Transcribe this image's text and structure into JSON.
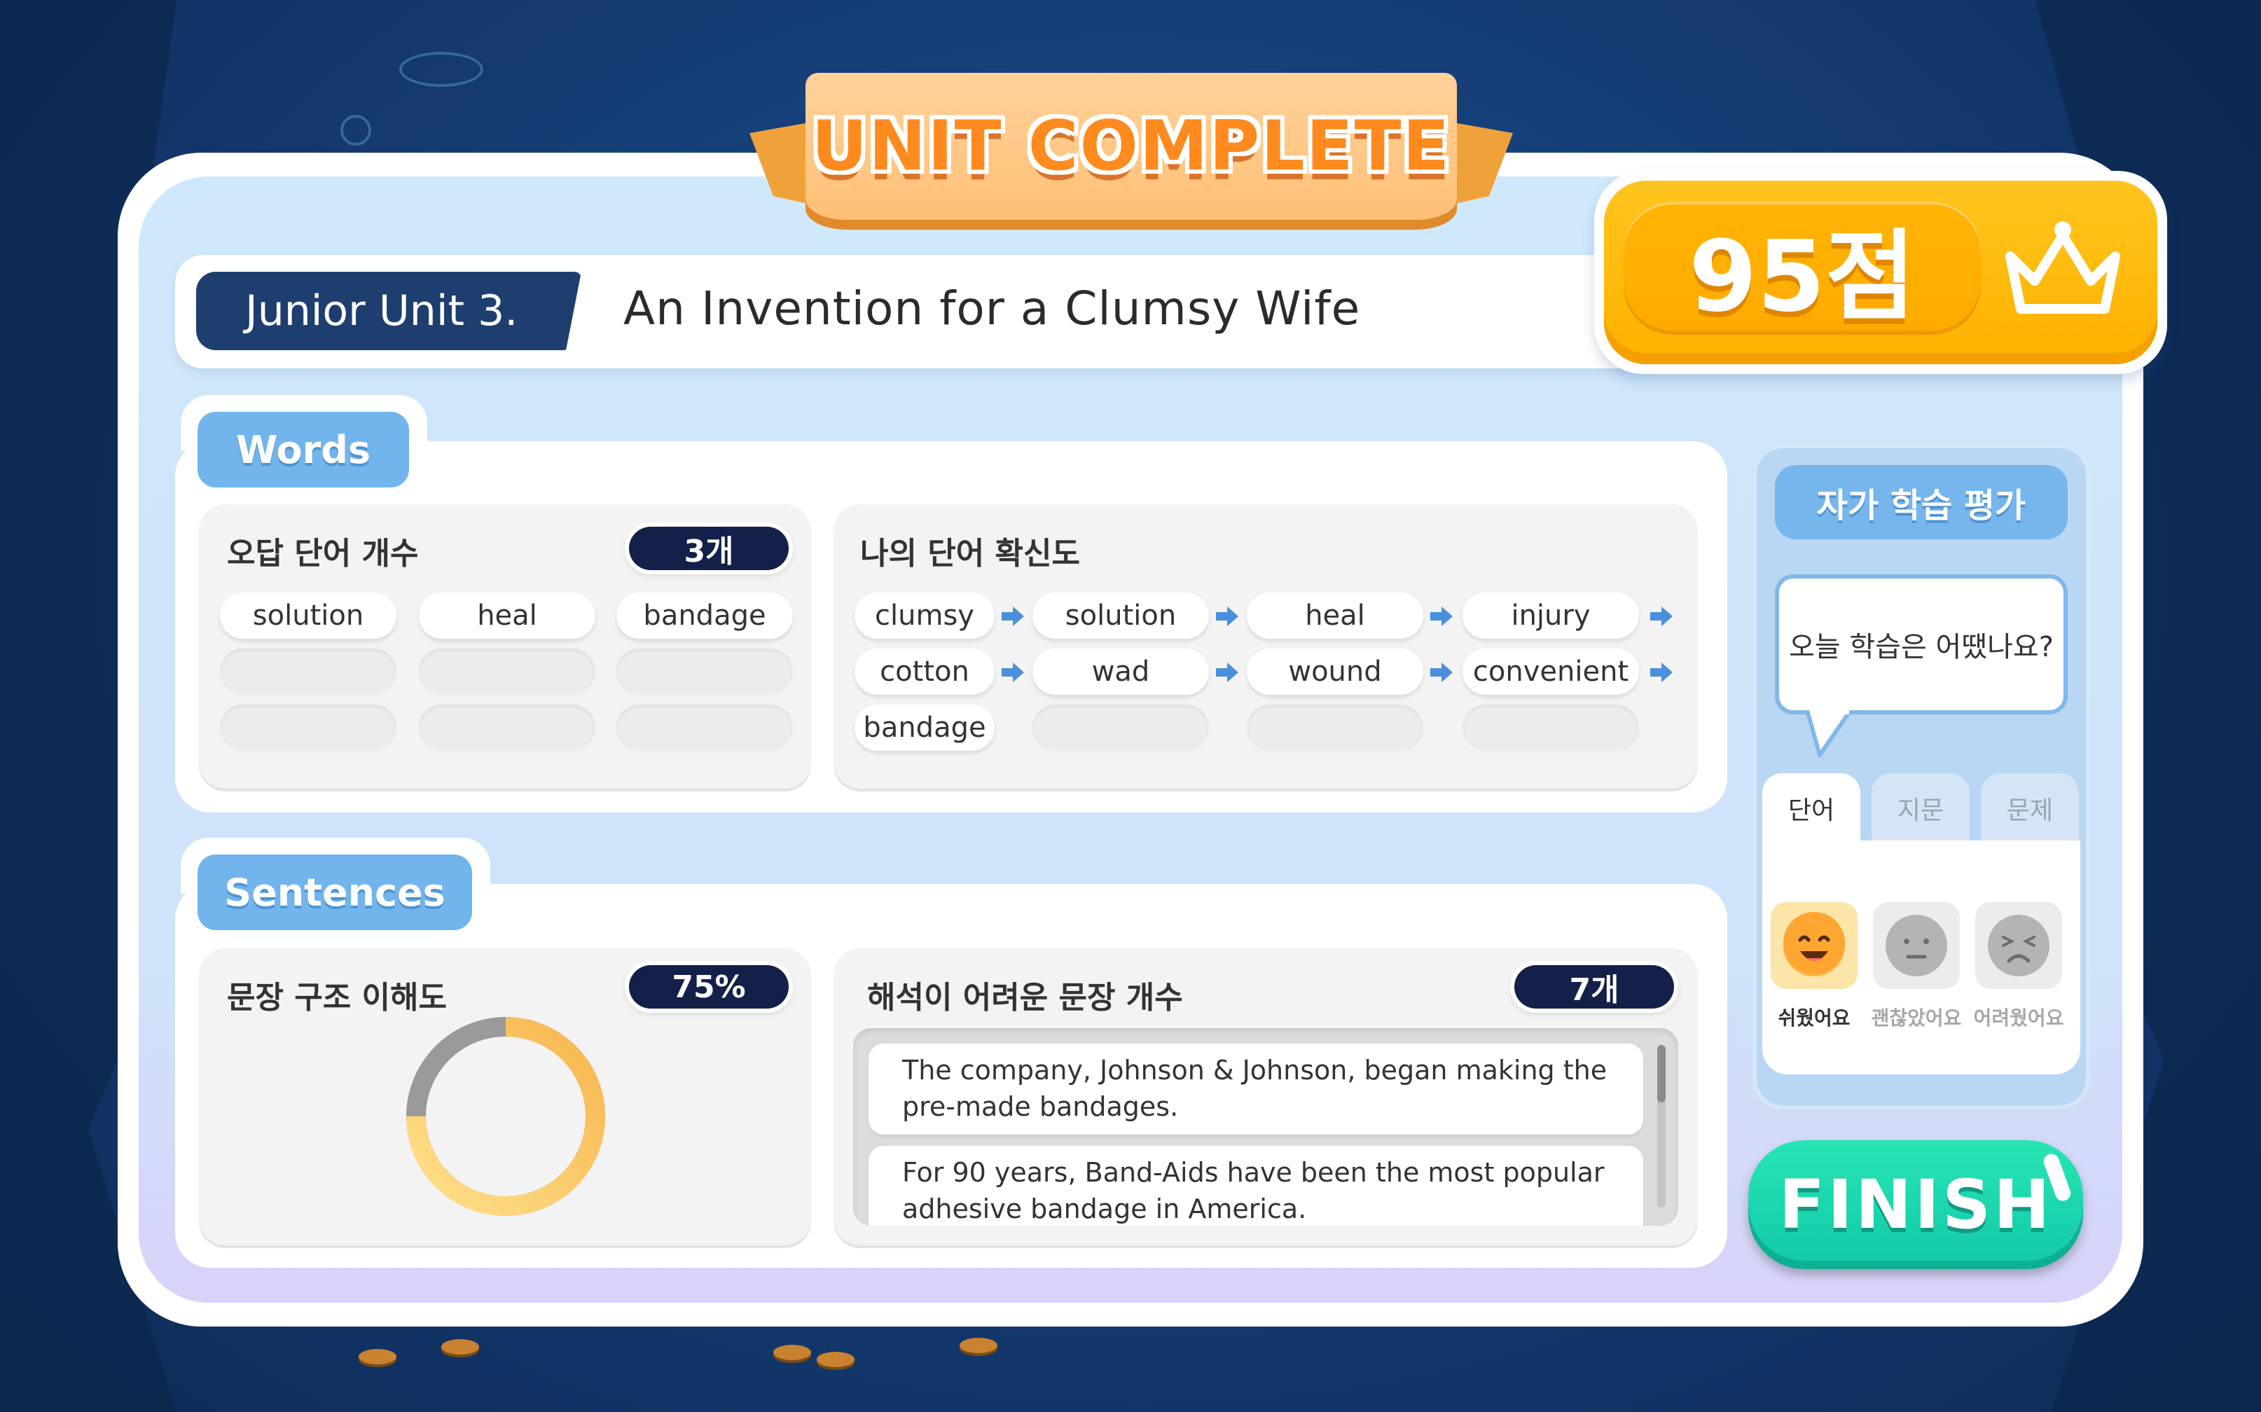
{
  "banner": {
    "title": "UNIT COMPLETE"
  },
  "header": {
    "unit_tag": "Junior Unit 3.",
    "title": "An Invention for a Clumsy Wife"
  },
  "score": {
    "value": "95점",
    "icon": "crown-icon"
  },
  "words": {
    "section_label": "Words",
    "wrong": {
      "title": "오답 단어 개수",
      "count": "3개",
      "items": [
        "solution",
        "heal",
        "bandage",
        "",
        "",
        "",
        "",
        "",
        ""
      ]
    },
    "confidence": {
      "title": "나의 단어 확신도",
      "items": [
        "clumsy",
        "solution",
        "heal",
        "injury",
        "cotton",
        "wad",
        "wound",
        "convenient",
        "bandage",
        "",
        "",
        ""
      ]
    }
  },
  "sentences": {
    "section_label": "Sentences",
    "structure": {
      "title": "문장 구조 이해도",
      "percent": "75%",
      "value": 75
    },
    "difficult": {
      "title": "해석이 어려운 문장 개수",
      "count": "7개",
      "items": [
        "The company, Johnson & Johnson, began making the pre-made bandages.",
        "For 90 years, Band-Aids have been the most popular adhesive bandage in America."
      ]
    }
  },
  "self_assessment": {
    "label": "자가 학습 평가",
    "question": "오늘 학습은 어땠나요?",
    "tabs": [
      "단어",
      "지문",
      "문제"
    ],
    "active_tab": 0,
    "ratings": [
      {
        "label": "쉬웠어요",
        "icon": "happy-face-icon",
        "selected": true
      },
      {
        "label": "괜찮았어요",
        "icon": "neutral-face-icon",
        "selected": false
      },
      {
        "label": "어려웠어요",
        "icon": "sad-face-icon",
        "selected": false
      }
    ]
  },
  "finish_button": {
    "label": "FINISH"
  },
  "colors": {
    "accent": "#72b5ec",
    "navy": "#13204a",
    "score": "#ffb100",
    "finish": "#1ed7ae",
    "banner": "#ff8a1e"
  }
}
